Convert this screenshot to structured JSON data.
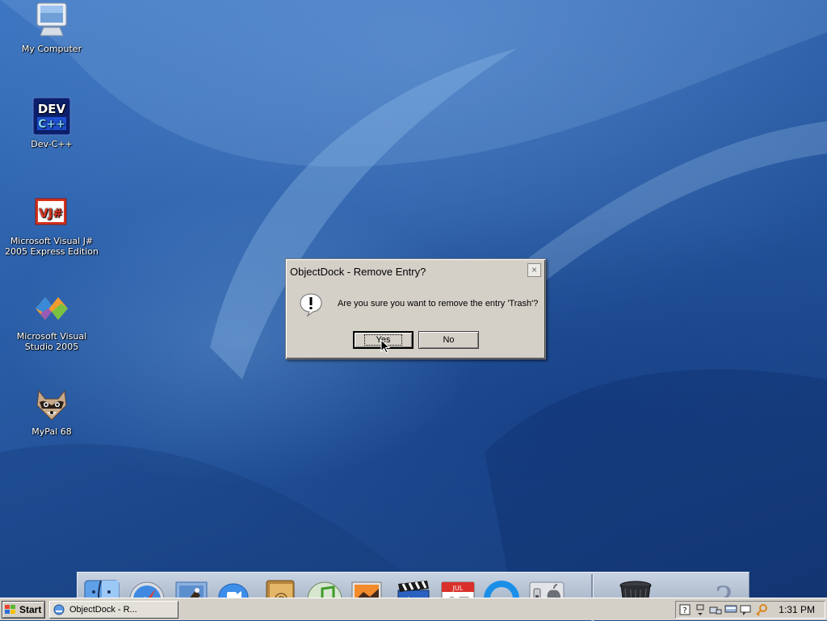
{
  "desktop": {
    "icons": [
      {
        "label": "My Computer",
        "icon": "computer-icon"
      },
      {
        "label": "Dev-C++",
        "icon": "devcpp-icon",
        "logo_text_top": "DEV",
        "logo_text_bottom": "C++"
      },
      {
        "label": "Microsoft Visual J# 2005 Express Edition",
        "icon": "visual-jsharp-icon",
        "logo_text": "VJ#"
      },
      {
        "label": "Microsoft Visual Studio 2005",
        "icon": "visual-studio-icon"
      },
      {
        "label": "MyPal 68",
        "icon": "mypal-raccoon-icon"
      }
    ]
  },
  "dialog": {
    "title": "ObjectDock - Remove Entry?",
    "close_label": "×",
    "message": "Are you sure you want to remove the entry 'Trash'?",
    "icon": "exclamation-icon",
    "yes_label": "Yes",
    "no_label": "No"
  },
  "dock": {
    "items": [
      {
        "icon": "finder-icon"
      },
      {
        "icon": "safari-icon"
      },
      {
        "icon": "mail-icon"
      },
      {
        "icon": "ichat-icon"
      },
      {
        "icon": "address-book-icon"
      },
      {
        "icon": "itunes-icon"
      },
      {
        "icon": "iphoto-icon"
      },
      {
        "icon": "imovie-icon"
      },
      {
        "icon": "ical-icon",
        "month": "JUL",
        "day": "17"
      },
      {
        "icon": "quicktime-icon"
      },
      {
        "icon": "system-preferences-icon"
      },
      {
        "icon": "trash-icon"
      },
      {
        "icon": "help-icon"
      }
    ]
  },
  "taskbar": {
    "start_label": "Start",
    "task_label": "ObjectDock - R...",
    "tray_icons": [
      "help-tray-icon",
      "restore-tray-icon",
      "network-tray-icon",
      "monitor-tray-icon",
      "chat-tray-icon",
      "key-tray-icon"
    ],
    "clock": "1:31 PM"
  },
  "colors": {
    "dialog_face": "#d4d0c8",
    "wallpaper": "#2a5ea8",
    "dock": "#aab8cb"
  }
}
